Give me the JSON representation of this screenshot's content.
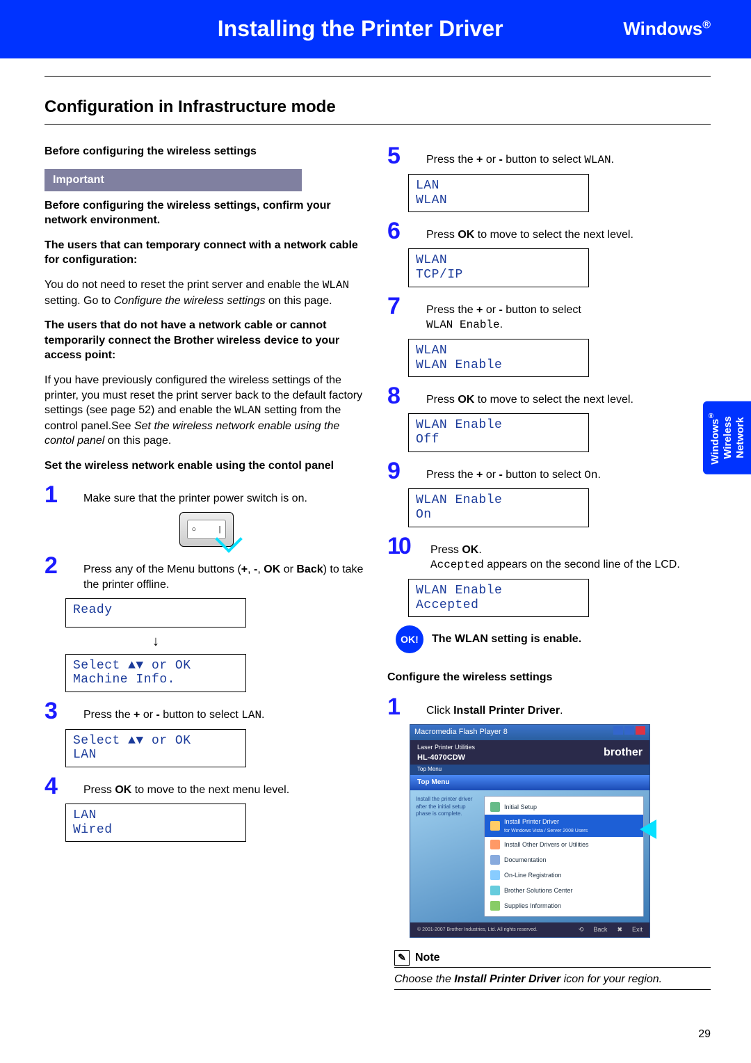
{
  "header": {
    "title": "Installing the Printer Driver",
    "os": "Windows",
    "os_sup": "®"
  },
  "section_title": "Configuration in Infrastructure mode",
  "left": {
    "pre_head": "Before configuring the wireless settings",
    "important_label": "Important",
    "imp_p1": "Before configuring the wireless settings, confirm your  network environment.",
    "imp_p2": "The users that can temporary connect with a network cable for configuration:",
    "p1a": "You do not need to reset the print server and enable the ",
    "p1_code": "WLAN",
    "p1b": " setting. Go to ",
    "p1_italic": "Configure the wireless settings",
    "p1c": " on this page.",
    "imp_p3": "The users that do not have a network cable or cannot temporarily connect the Brother wireless device to your access point:",
    "p2a": "If you have previously configured the wireless settings of the printer, you must reset the print server back to the default factory settings (see page 52) and enable the ",
    "p2_code": "WLAN",
    "p2b": " setting from the control panel.See ",
    "p2_italic": "Set the wireless network enable using the contol panel",
    "p2c": " on this page.",
    "set_head": "Set the wireless network enable using the contol panel",
    "step1": "Make sure that the printer power switch is on.",
    "step2a": "Press any of the Menu buttons (",
    "step2_plus": "+",
    "step2_sep1": ", ",
    "step2_minus": "-",
    "step2_sep2": ", ",
    "step2_ok": "OK",
    "step2_or": " or ",
    "step2_back": "Back",
    "step2b": ") to take the printer offline.",
    "lcd_ready": "Ready",
    "lcd_select1_l1": "Select ▲▼ or OK",
    "lcd_select1_l2": "Machine Info.",
    "step3a": "Press the ",
    "step3_plus": "+",
    "step3_or": " or ",
    "step3_minus": "-",
    "step3b": " button to select ",
    "step3_code": "LAN",
    "step3c": ".",
    "lcd_select2_l1": "Select ▲▼ or OK",
    "lcd_select2_l2": "LAN",
    "step4a": "Press ",
    "step4_ok": "OK",
    "step4b": " to move to the next menu level.",
    "lcd_lan_l1": "LAN",
    "lcd_lan_l2": "Wired"
  },
  "right": {
    "step5a": "Press the ",
    "step5_plus": "+",
    "step5_or": " or ",
    "step5_minus": "-",
    "step5b": " button to select ",
    "step5_code": "WLAN",
    "step5c": ".",
    "lcd5_l1": "LAN",
    "lcd5_l2": "WLAN",
    "step6a": "Press ",
    "step6_ok": "OK",
    "step6b": " to move to select the next level.",
    "lcd6_l1": "WLAN",
    "lcd6_l2": "TCP/IP",
    "step7a": "Press the ",
    "step7_plus": "+",
    "step7_or": " or ",
    "step7_minus": "-",
    "step7b": " button to select ",
    "step7_code": "WLAN Enable",
    "step7c": ".",
    "lcd7_l1": "WLAN",
    "lcd7_l2": "WLAN Enable",
    "step8a": "Press ",
    "step8_ok": "OK",
    "step8b": " to move to select the next level.",
    "lcd8_l1": "WLAN Enable",
    "lcd8_l2": "Off",
    "step9a": "Press the ",
    "step9_plus": "+",
    "step9_or": " or ",
    "step9_minus": "-",
    "step9b": " button to select ",
    "step9_code": "On",
    "step9c": ".",
    "lcd9_l1": "WLAN Enable",
    "lcd9_l2": "On",
    "step10a": "Press ",
    "step10_ok": "OK",
    "step10b": ".",
    "step10c_code": "Accepted",
    "step10d": " appears on the second line of the LCD.",
    "lcd10_l1": "WLAN Enable",
    "lcd10_l2": "Accepted",
    "ok_badge": "OK!",
    "ok_text": "The WLAN setting is enable.",
    "config_head": "Configure the wireless settings",
    "cstep1a": "Click ",
    "cstep1_bold": "Install Printer Driver",
    "cstep1b": ".",
    "installer": {
      "titlebar": "Macromedia Flash Player 8",
      "product_line": "Laser Printer Utilities",
      "model": "HL-4070CDW",
      "brand": "brother",
      "tab": "Top Menu",
      "side_text": "Install the printer driver after the initial setup phase is complete.",
      "menu_items": [
        "Initial Setup",
        "Install Printer Driver",
        "Install Other Drivers or Utilities",
        "Documentation",
        "On-Line Registration",
        "Brother Solutions Center",
        "Supplies Information"
      ],
      "menu_subtext": "for Windows Vista / Server 2008 Users",
      "back": "Back",
      "exit": "Exit",
      "copyright": "© 2001-2007 Brother Industries, Ltd. All rights reserved."
    },
    "note_label": "Note",
    "note_a": "Choose the ",
    "note_bold": "Install Printer Driver",
    "note_b": " icon for your region."
  },
  "side_tab": {
    "l1": "Windows",
    "sup": "®",
    "l2": "Wireless",
    "l3": "Network"
  },
  "page_no": "29"
}
